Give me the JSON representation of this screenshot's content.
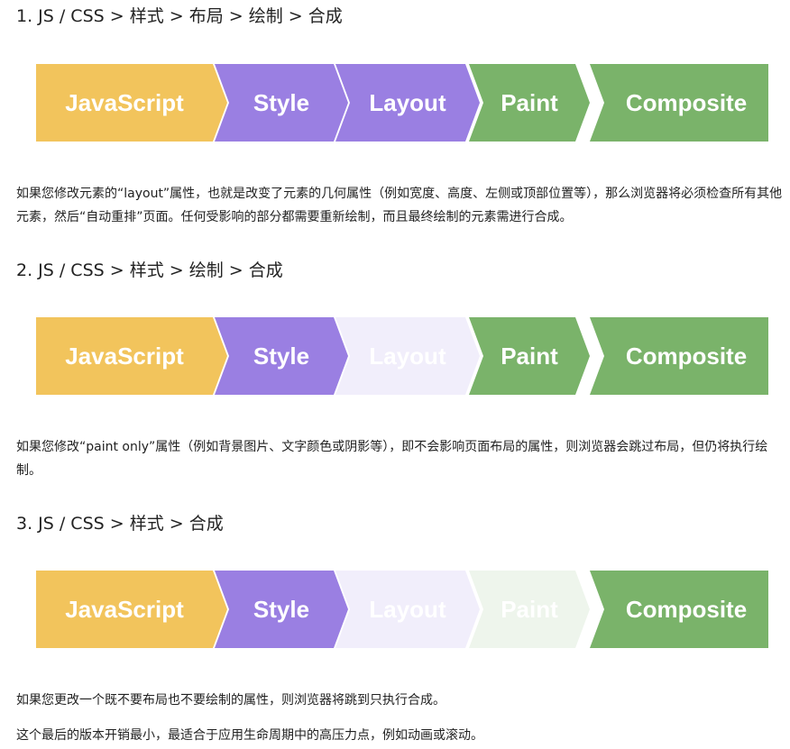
{
  "sections": [
    {
      "heading": "1. JS / CSS > 样式 > 布局 > 绘制 > 合成",
      "stages": [
        {
          "label": "JavaScript",
          "color": "#f2c45c",
          "faded": false
        },
        {
          "label": "Style",
          "color": "#9a7fe2",
          "faded": false
        },
        {
          "label": "Layout",
          "color": "#9a7fe2",
          "faded": false
        },
        {
          "label": "Paint",
          "color": "#7ab36a",
          "faded": false
        },
        {
          "label": "Composite",
          "color": "#7ab36a",
          "faded": false
        }
      ],
      "paragraphs": [
        "如果您修改元素的“layout”属性，也就是改变了元素的几何属性（例如宽度、高度、左侧或顶部位置等），那么浏览器将必须检查所有其他元素，然后“自动重排”页面。任何受影响的部分都需要重新绘制，而且最终绘制的元素需进行合成。"
      ]
    },
    {
      "heading": "2. JS / CSS > 样式 > 绘制 > 合成",
      "stages": [
        {
          "label": "JavaScript",
          "color": "#f2c45c",
          "faded": false
        },
        {
          "label": "Style",
          "color": "#9a7fe2",
          "faded": false
        },
        {
          "label": "Layout",
          "color": "#f1eefb",
          "faded": true
        },
        {
          "label": "Paint",
          "color": "#7ab36a",
          "faded": false
        },
        {
          "label": "Composite",
          "color": "#7ab36a",
          "faded": false
        }
      ],
      "paragraphs": [
        "如果您修改“paint only”属性（例如背景图片、文字颜色或阴影等），即不会影响页面布局的属性，则浏览器会跳过布局，但仍将执行绘制。"
      ]
    },
    {
      "heading": "3. JS / CSS > 样式 > 合成",
      "stages": [
        {
          "label": "JavaScript",
          "color": "#f2c45c",
          "faded": false
        },
        {
          "label": "Style",
          "color": "#9a7fe2",
          "faded": false
        },
        {
          "label": "Layout",
          "color": "#f1eefb",
          "faded": true
        },
        {
          "label": "Paint",
          "color": "#eef5ec",
          "faded": true
        },
        {
          "label": "Composite",
          "color": "#7ab36a",
          "faded": false
        }
      ],
      "paragraphs": [
        "如果您更改一个既不要布局也不要绘制的属性，则浏览器将跳到只执行合成。",
        "这个最后的版本开销最小，最适合于应用生命周期中的高压力点，例如动画或滚动。"
      ]
    }
  ]
}
